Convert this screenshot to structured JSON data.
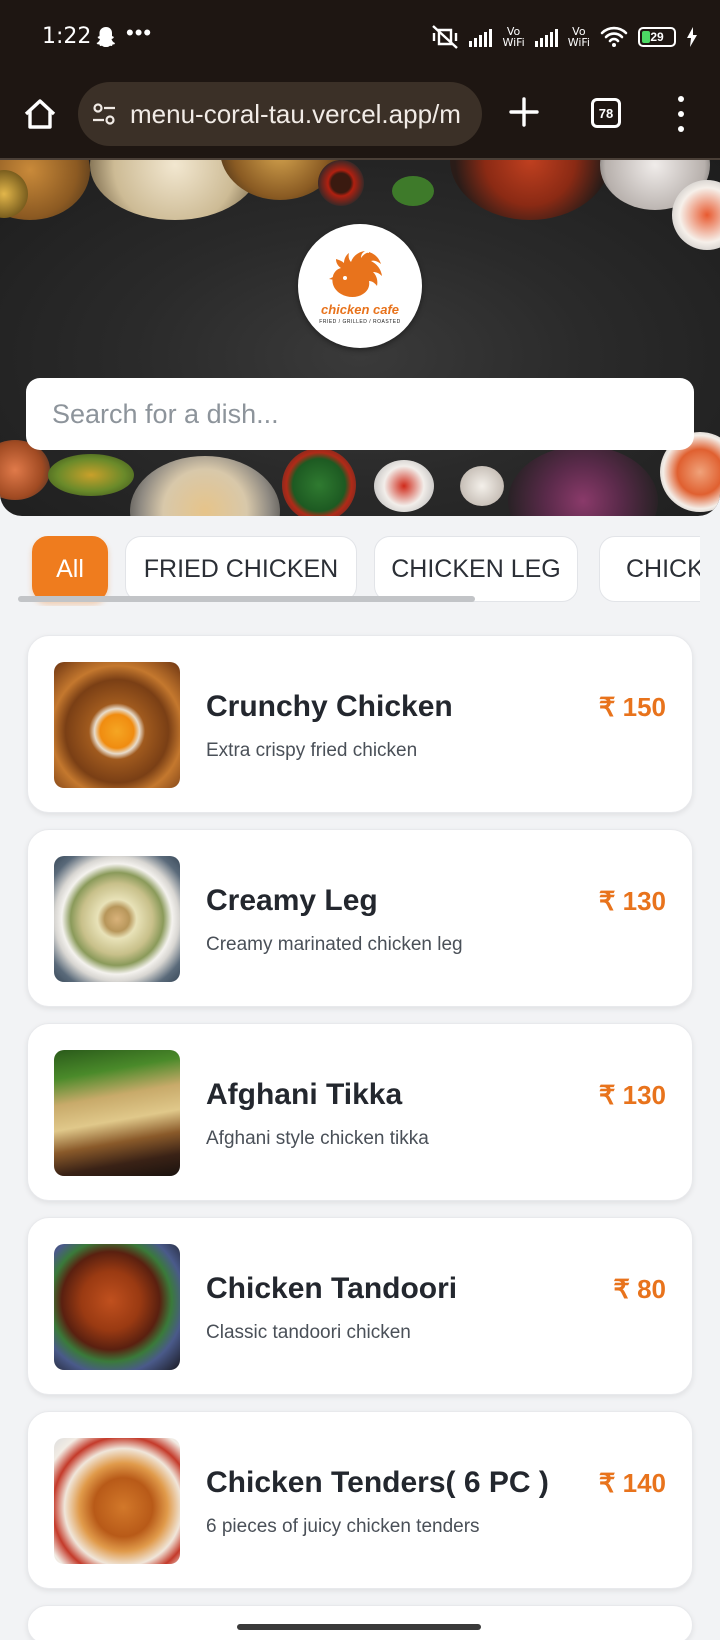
{
  "status_bar": {
    "time": "1:22",
    "more": "•••",
    "vowifi_label_1": "Vo\nWiFi",
    "vowifi_label_2": "Vo\nWiFi",
    "battery_level": "29"
  },
  "browser": {
    "url": "menu-coral-tau.vercel.app/m",
    "tab_count": "78"
  },
  "hero": {
    "logo_text": "chicken cafe",
    "logo_subtext": "FRIED / GRILLED / ROASTED",
    "search_placeholder": "Search for a dish..."
  },
  "categories": [
    {
      "label": "All",
      "active": true
    },
    {
      "label": "FRIED CHICKEN",
      "active": false
    },
    {
      "label": "CHICKEN LEG",
      "active": false
    },
    {
      "label": "CHICK",
      "active": false
    }
  ],
  "menu_items": [
    {
      "name": "Crunchy Chicken",
      "description": "Extra crispy fried chicken",
      "price": "₹ 150"
    },
    {
      "name": "Creamy Leg",
      "description": "Creamy marinated chicken leg",
      "price": "₹ 130"
    },
    {
      "name": "Afghani Tikka",
      "description": "Afghani style chicken tikka",
      "price": "₹ 130"
    },
    {
      "name": "Chicken Tandoori",
      "description": "Classic tandoori chicken",
      "price": "₹ 80"
    },
    {
      "name": "Chicken Tenders( 6 PC )",
      "description": "6 pieces of juicy chicken tenders",
      "price": "₹ 140"
    }
  ],
  "colors": {
    "accent": "#ef7c1e",
    "price": "#e8731c",
    "status_bar_bg": "#1e1612"
  },
  "icons": {
    "home": "home-icon",
    "site_settings": "tune-icon",
    "new_tab": "plus-icon",
    "tabs": "tab-counter-icon",
    "menu": "more-vert-icon"
  }
}
